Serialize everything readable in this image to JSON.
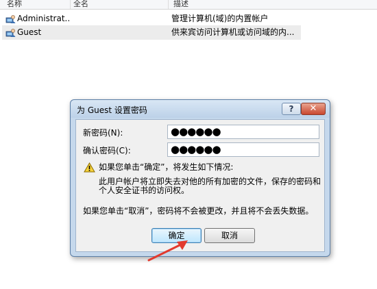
{
  "list": {
    "columns": [
      "名称",
      "全名",
      "描述"
    ],
    "rows": [
      {
        "name": "Administrat...",
        "full_name": "",
        "description": "管理计算机(域)的内置帐户",
        "icon": "user-icon"
      },
      {
        "name": "Guest",
        "full_name": "",
        "description": "供来宾访问计算机或访问域的内...",
        "icon": "user-icon",
        "selected": true
      }
    ]
  },
  "dialog": {
    "title": "为 Guest 设置密码",
    "help_glyph": "?",
    "close_glyph": "✕",
    "new_password_label": "新密码(N):",
    "new_password_value": "●●●●●●",
    "confirm_password_label": "确认密码(C):",
    "confirm_password_value": "●●●●●●",
    "warning_heading": "如果您单击“确定”，将发生如下情况:",
    "warning_body_line1": "此用户帐户将立即失去对他的所有加密的文件，保存的密码和",
    "warning_body_line2": "个人安全证书的访问权。",
    "cancel_note": "如果您单击“取消”，密码将不会被更改，并且将不会丢失数据。",
    "ok_label": "确定",
    "cancel_label": "取消"
  },
  "colors": {
    "dialog_frame": "#c5d8ec",
    "close_button": "#c9472f",
    "annotation_arrow": "#e23a2e"
  }
}
